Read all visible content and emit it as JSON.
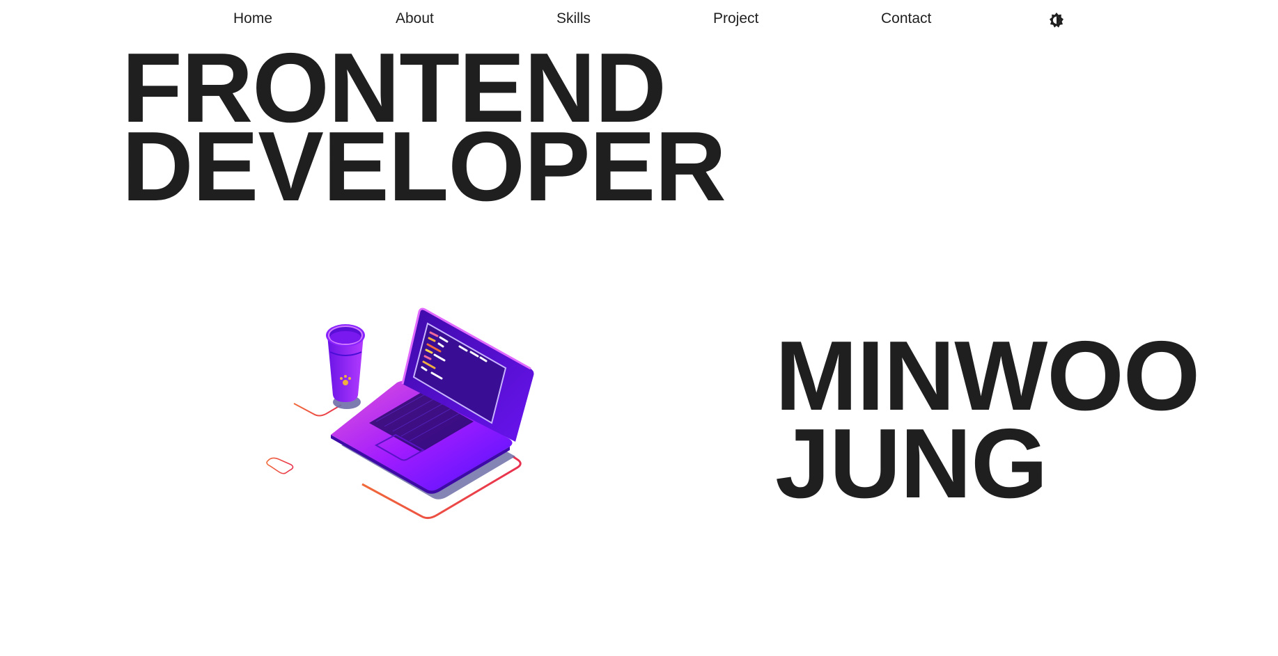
{
  "nav": {
    "items": [
      {
        "label": "Home"
      },
      {
        "label": "About"
      },
      {
        "label": "Skills"
      },
      {
        "label": "Project"
      },
      {
        "label": "Contact"
      }
    ],
    "theme_toggle_icon": "brightness-icon"
  },
  "hero": {
    "line1": "FRONTEND",
    "line2": "DEVELOPER"
  },
  "name": {
    "line1": "MINWOO",
    "line2": "JUNG"
  },
  "illustration": {
    "icon": "laptop-coffee-illustration",
    "colors": {
      "purple": "#7b1cff",
      "violet": "#4a0fd6",
      "magenta": "#c23cff",
      "outline": "#ef3b4f",
      "orange": "#f06a3a"
    }
  },
  "colors": {
    "text": "#1f1f1f",
    "background": "#ffffff"
  }
}
